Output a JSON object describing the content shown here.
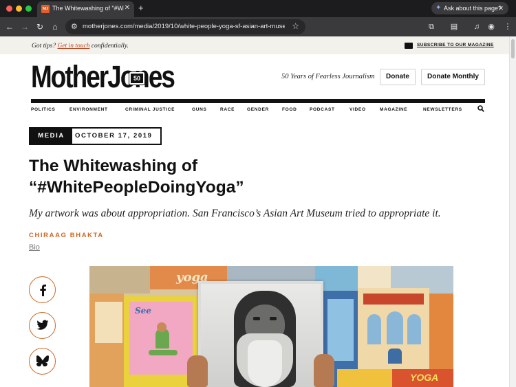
{
  "browser": {
    "tab_title": "The Whitewashing of \"#White",
    "tab_favicon": "MJ",
    "ask_label": "Ask about this page?",
    "url": "motherjones.com/media/2019/10/white-people-yoga-sf-asian-art-museu...",
    "icons": [
      "close-icon",
      "plus-icon",
      "sparkle-icon",
      "back-icon",
      "forward-icon",
      "reload-icon",
      "home-icon",
      "site-info-icon",
      "star-icon",
      "extensions-icon",
      "reader-icon",
      "media-icon",
      "profile-icon",
      "menu-icon"
    ]
  },
  "site": {
    "tips_prefix": "Got tips?",
    "tips_link": "Get in touch",
    "tips_suffix": "confidentially.",
    "subscribe_label": "SUBSCRIBE TO OUR MAGAZINE",
    "logo_text": "MotherJones",
    "logo_badge": "50",
    "years_text": "50 Years of Fearless Journalism",
    "donate_label": "Donate",
    "donate_monthly_label": "Donate Monthly",
    "nav": [
      "POLITICS",
      "ENVIRONMENT",
      "CRIMINAL JUSTICE",
      "GUNS",
      "RACE",
      "GENDER",
      "FOOD",
      "PODCAST",
      "VIDEO",
      "MAGAZINE",
      "NEWSLETTERS"
    ]
  },
  "article": {
    "category": "MEDIA",
    "date": "OCTOBER 17, 2019",
    "headline_line1": "The Whitewashing of",
    "headline_line2": "“#WhitePeopleDoingYoga”",
    "dek": "My artwork was about appropriation. San Francisco’s Asian Art Museum tried to appropriate it.",
    "author": "CHIRAAG BHAKTA",
    "bio_label": "Bio",
    "share_icons": [
      "facebook-icon",
      "twitter-icon",
      "bluesky-icon"
    ]
  },
  "hero": {
    "label_yoga": "yoga",
    "label_see": "See",
    "label_yoga2": "YOGA"
  },
  "colors": {
    "accent": "#d0651f",
    "tips_link": "#b8431b",
    "ink": "#111111"
  }
}
